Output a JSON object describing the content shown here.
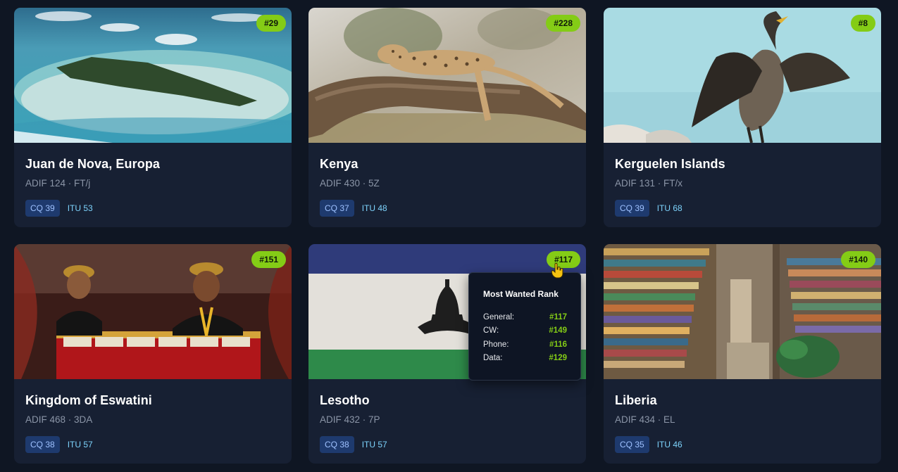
{
  "cards": [
    {
      "title": "Juan de Nova, Europa",
      "meta": "ADIF 124 · FT/j",
      "rank": "#29",
      "cq": "CQ 39",
      "itu": "ITU 53"
    },
    {
      "title": "Kenya",
      "meta": "ADIF 430 · 5Z",
      "rank": "#228",
      "cq": "CQ 37",
      "itu": "ITU 48"
    },
    {
      "title": "Kerguelen Islands",
      "meta": "ADIF 131 · FT/x",
      "rank": "#8",
      "cq": "CQ 39",
      "itu": "ITU 68"
    },
    {
      "title": "Kingdom of Eswatini",
      "meta": "ADIF 468 · 3DA",
      "rank": "#151",
      "cq": "CQ 38",
      "itu": "ITU 57"
    },
    {
      "title": "Lesotho",
      "meta": "ADIF 432 · 7P",
      "rank": "#117",
      "cq": "CQ 38",
      "itu": "ITU 57"
    },
    {
      "title": "Liberia",
      "meta": "ADIF 434 · EL",
      "rank": "#140",
      "cq": "CQ 35",
      "itu": "ITU 46"
    }
  ],
  "tooltip": {
    "title": "Most Wanted Rank",
    "rows": [
      {
        "label": "General:",
        "value": "#117"
      },
      {
        "label": "CW:",
        "value": "#149"
      },
      {
        "label": "Phone:",
        "value": "#116"
      },
      {
        "label": "Data:",
        "value": "#129"
      }
    ]
  },
  "colors": {
    "accent": "#84cc16",
    "card_bg": "#172033",
    "page_bg": "#0f1623",
    "cq_bg": "#1e3a6e",
    "itu_text": "#7dd3fc"
  }
}
